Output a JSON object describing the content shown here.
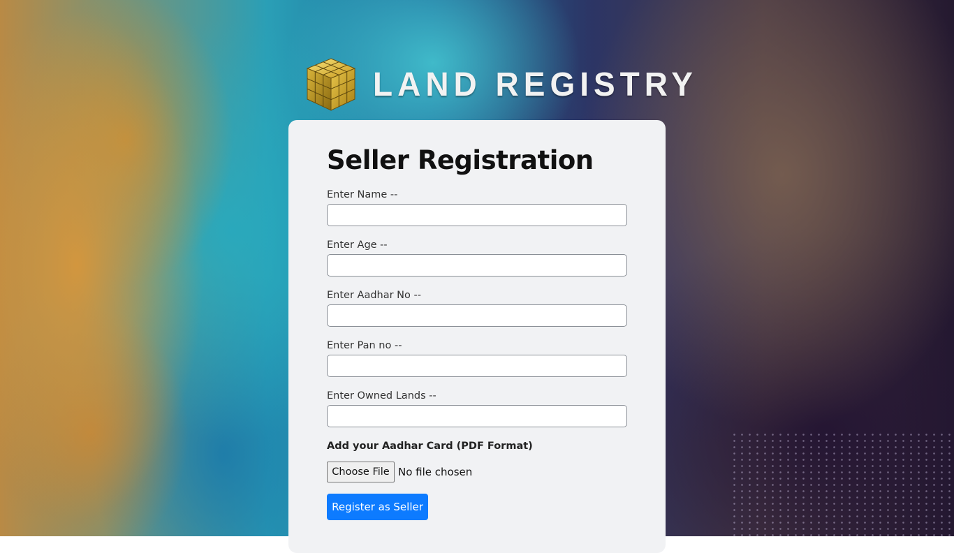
{
  "brand": {
    "logo_text": "LAND REGISTRY"
  },
  "form": {
    "title": "Seller Registration",
    "fields": [
      {
        "label": "Enter Name --",
        "value": "",
        "placeholder": ""
      },
      {
        "label": "Enter Age --",
        "value": "",
        "placeholder": ""
      },
      {
        "label": "Enter Aadhar No --",
        "value": "",
        "placeholder": ""
      },
      {
        "label": "Enter Pan no --",
        "value": "",
        "placeholder": ""
      },
      {
        "label": "Enter Owned Lands --",
        "value": "",
        "placeholder": ""
      }
    ],
    "upload": {
      "label": "Add your Aadhar Card (PDF Format)",
      "button_label": "Choose File",
      "status": "No file chosen"
    },
    "submit_label": "Register as Seller"
  },
  "colors": {
    "primary_button": "#0d7bff",
    "card_bg": "#f1f2f4",
    "logo_gold": "#d4af37"
  }
}
